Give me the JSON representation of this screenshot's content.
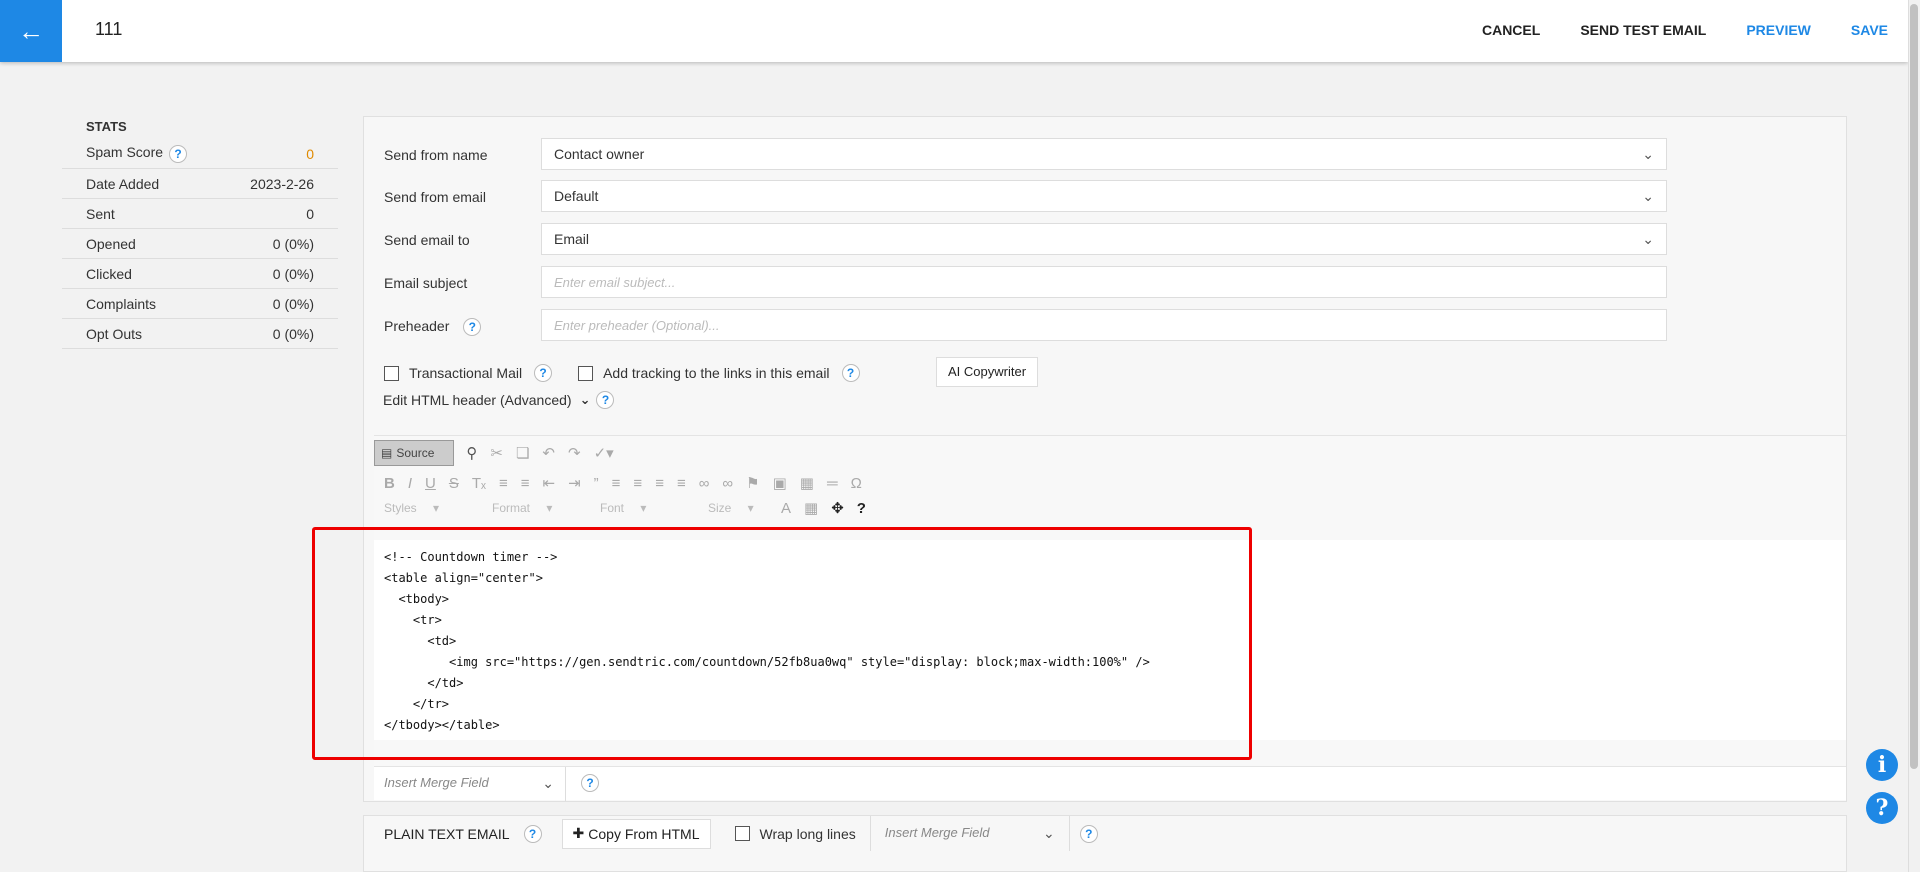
{
  "header": {
    "title": "111",
    "actions": {
      "cancel": "CANCEL",
      "send_test": "SEND TEST EMAIL",
      "preview": "PREVIEW",
      "save": "SAVE"
    }
  },
  "stats": {
    "title": "STATS",
    "rows": [
      {
        "label": "Spam Score",
        "value": "0"
      },
      {
        "label": "Date Added",
        "value": "2023-2-26"
      },
      {
        "label": "Sent",
        "value": "0"
      },
      {
        "label": "Opened",
        "value": "0 (0%)"
      },
      {
        "label": "Clicked",
        "value": "0 (0%)"
      },
      {
        "label": "Complaints",
        "value": "0 (0%)"
      },
      {
        "label": "Opt Outs",
        "value": "0 (0%)"
      }
    ]
  },
  "form": {
    "send_from_name": {
      "label": "Send from name",
      "value": "Contact owner"
    },
    "send_from_email": {
      "label": "Send from email",
      "value": "Default"
    },
    "send_email_to": {
      "label": "Send email to",
      "value": "Email"
    },
    "email_subject": {
      "label": "Email subject",
      "placeholder": "Enter email subject..."
    },
    "preheader": {
      "label": "Preheader",
      "placeholder": "Enter preheader (Optional)..."
    },
    "transactional_label": "Transactional Mail",
    "tracking_label": "Add tracking to the links in this email",
    "ai_button": "AI Copywriter",
    "html_header_label": "Edit HTML header (Advanced)"
  },
  "editor": {
    "source_label": "Source",
    "styles_label": "Styles",
    "format_label": "Format",
    "font_label": "Font",
    "size_label": "Size",
    "code_lines": [
      "<!-- Countdown timer -->",
      "<table align=\"center\">",
      "  <tbody>",
      "    <tr>",
      "      <td>",
      "         <img src=\"https://gen.sendtric.com/countdown/52fb8ua0wq\" style=\"display: block;max-width:100%\" />",
      "      </td>",
      "    </tr>",
      "</tbody></table>"
    ],
    "merge_field": "Insert Merge Field"
  },
  "plain_text": {
    "title": "PLAIN TEXT EMAIL",
    "copy_button": "Copy From HTML",
    "wrap_label": "Wrap long lines",
    "merge_field": "Insert Merge Field"
  },
  "help_q": "?",
  "colors": {
    "accent": "#1e88e5",
    "highlight": "#e00000",
    "spam_value": "#e08a00"
  }
}
